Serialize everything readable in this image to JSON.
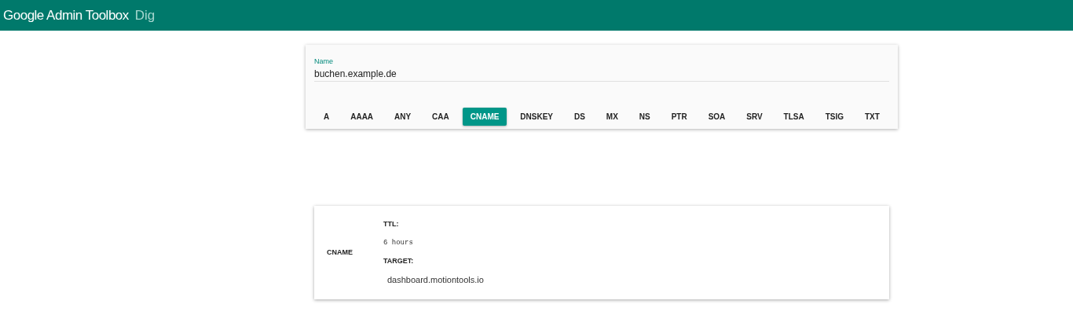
{
  "header": {
    "title": "Google Admin Toolbox",
    "subtitle": "Dig"
  },
  "form": {
    "name_field": {
      "label": "Name",
      "value": "buchen.example.de"
    },
    "record_types": [
      {
        "label": "A",
        "selected": false
      },
      {
        "label": "AAAA",
        "selected": false
      },
      {
        "label": "ANY",
        "selected": false
      },
      {
        "label": "CAA",
        "selected": false
      },
      {
        "label": "CNAME",
        "selected": true
      },
      {
        "label": "DNSKEY",
        "selected": false
      },
      {
        "label": "DS",
        "selected": false
      },
      {
        "label": "MX",
        "selected": false
      },
      {
        "label": "NS",
        "selected": false
      },
      {
        "label": "PTR",
        "selected": false
      },
      {
        "label": "SOA",
        "selected": false
      },
      {
        "label": "SRV",
        "selected": false
      },
      {
        "label": "TLSA",
        "selected": false
      },
      {
        "label": "TSIG",
        "selected": false
      },
      {
        "label": "TXT",
        "selected": false
      }
    ]
  },
  "result": {
    "type": "CNAME",
    "ttl_label": "TTL:",
    "ttl": "6 hours",
    "target_label": "TARGET:",
    "target": "dashboard.motiontools.io"
  }
}
